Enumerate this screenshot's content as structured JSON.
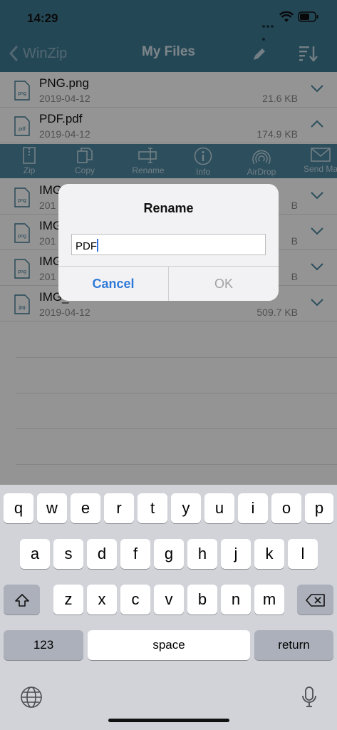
{
  "status": {
    "time": "14:29"
  },
  "nav": {
    "back_label": "WinZip",
    "title": "My Files"
  },
  "files": [
    {
      "icon": "png",
      "name": "PNG.png",
      "date": "2019-04-12",
      "size": "21.6 KB",
      "chevron": "down"
    },
    {
      "icon": "pdf",
      "name": "PDF.pdf",
      "date": "2019-04-12",
      "size": "174.9 KB",
      "chevron": "up"
    },
    {
      "icon": "png",
      "name": "IMG",
      "date": "201",
      "size": "B",
      "chevron": "down"
    },
    {
      "icon": "png",
      "name": "IMG",
      "date": "201",
      "size": "B",
      "chevron": "down"
    },
    {
      "icon": "png",
      "name": "IMG",
      "date": "201",
      "size": "B",
      "chevron": "down"
    },
    {
      "icon": "jpg",
      "name": "IMG_",
      "date": "2019-04-12",
      "size": "509.7 KB",
      "chevron": "down"
    }
  ],
  "actions": [
    {
      "label": "Zip",
      "icon": "zip-icon"
    },
    {
      "label": "Copy",
      "icon": "copy-icon"
    },
    {
      "label": "Rename",
      "icon": "rename-icon"
    },
    {
      "label": "Info",
      "icon": "info-icon"
    },
    {
      "label": "AirDrop",
      "icon": "airdrop-icon"
    },
    {
      "label": "Send Ma",
      "icon": "mail-icon"
    }
  ],
  "dialog": {
    "title": "Rename",
    "input_value": "PDF",
    "cancel_label": "Cancel",
    "ok_label": "OK"
  },
  "keyboard": {
    "row1": [
      "q",
      "w",
      "e",
      "r",
      "t",
      "y",
      "u",
      "i",
      "o",
      "p"
    ],
    "row2": [
      "a",
      "s",
      "d",
      "f",
      "g",
      "h",
      "j",
      "k",
      "l"
    ],
    "row3": [
      "z",
      "x",
      "c",
      "v",
      "b",
      "n",
      "m"
    ],
    "numbers_label": "123",
    "space_label": "space",
    "return_label": "return"
  },
  "colors": {
    "nav_bg": "#3f7a95",
    "toolbar_bg": "#4d87a1",
    "accent": "#2f7ad8",
    "keyboard_bg": "#d1d3d9"
  }
}
